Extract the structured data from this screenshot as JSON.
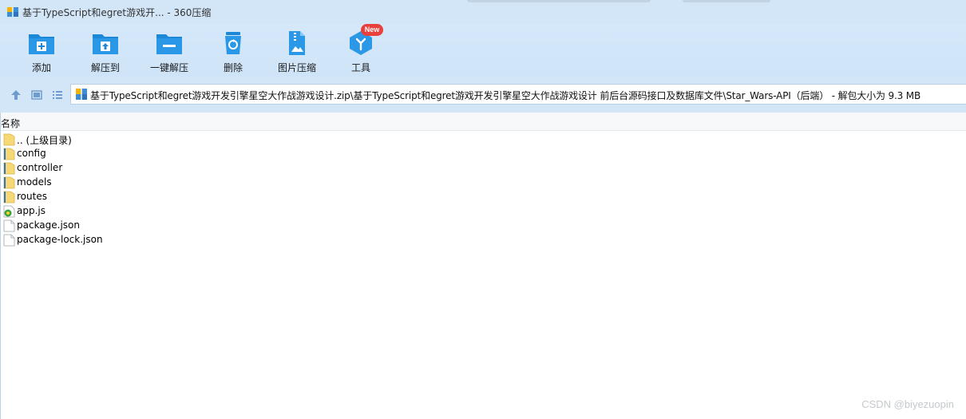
{
  "window": {
    "title": "基于TypeScript和egret游戏开... - 360压缩"
  },
  "toolbar": {
    "items": [
      {
        "label": "添加",
        "icon": "add-folder-icon"
      },
      {
        "label": "解压到",
        "icon": "extract-to-icon"
      },
      {
        "label": "一键解压",
        "icon": "one-click-extract-icon"
      },
      {
        "label": "删除",
        "icon": "recycle-delete-icon"
      },
      {
        "label": "图片压缩",
        "icon": "image-compress-icon"
      },
      {
        "label": "工具",
        "icon": "tools-cube-icon"
      }
    ],
    "new_badge": "New"
  },
  "address": {
    "path": "基于TypeScript和egret游戏开发引擎星空大作战游戏设计.zip\\基于TypeScript和egret游戏开发引擎星空大作战游戏设计 前后台源码接口及数据库文件\\Star_Wars-API（后端）  - 解包大小为 9.3 MB"
  },
  "columns": {
    "name": "名称"
  },
  "files": [
    {
      "name": ".. (上级目录)",
      "type": "folder"
    },
    {
      "name": "config",
      "type": "folder"
    },
    {
      "name": "controller",
      "type": "folder"
    },
    {
      "name": "models",
      "type": "folder"
    },
    {
      "name": "routes",
      "type": "folder"
    },
    {
      "name": "app.js",
      "type": "js"
    },
    {
      "name": "package.json",
      "type": "file"
    },
    {
      "name": "package-lock.json",
      "type": "file"
    }
  ],
  "watermark": "CSDN @biyezuopin",
  "colors": {
    "accent": "#1e88d8",
    "toolbar_bg": "#d3e6f8",
    "badge": "#e8403a"
  }
}
